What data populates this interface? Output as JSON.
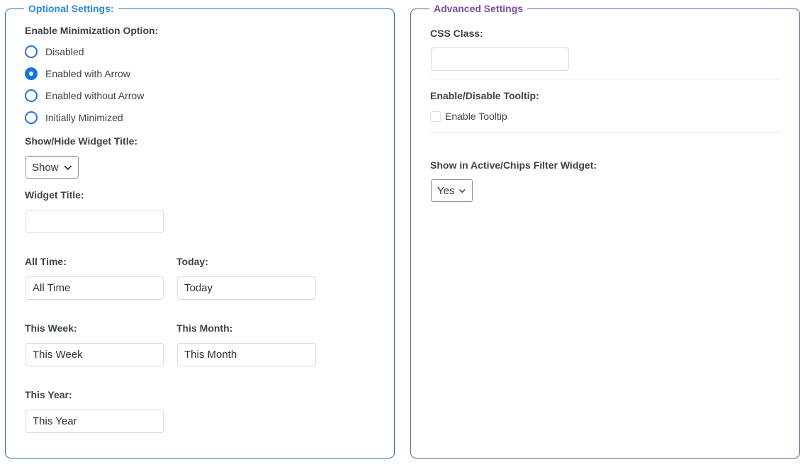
{
  "optional": {
    "legend": "Optional Settings:",
    "minimization": {
      "label": "Enable Minimization Option:",
      "options": [
        {
          "label": "Disabled",
          "checked": false
        },
        {
          "label": "Enabled with Arrow",
          "checked": true
        },
        {
          "label": "Enabled without Arrow",
          "checked": false
        },
        {
          "label": "Initially Minimized",
          "checked": false
        }
      ]
    },
    "show_hide_title": {
      "label": "Show/Hide Widget Title:",
      "selected": "Show"
    },
    "widget_title": {
      "label": "Widget Title:",
      "value": ""
    },
    "all_time": {
      "label": "All Time:",
      "value": "All Time"
    },
    "today": {
      "label": "Today:",
      "value": "Today"
    },
    "this_week": {
      "label": "This Week:",
      "value": "This Week"
    },
    "this_month": {
      "label": "This Month:",
      "value": "This Month"
    },
    "this_year": {
      "label": "This Year:",
      "value": "This Year"
    }
  },
  "advanced": {
    "legend": "Advanced Settings",
    "css_class": {
      "label": "CSS Class:",
      "value": ""
    },
    "tooltip": {
      "label": "Enable/Disable Tooltip:",
      "checkbox_label": "Enable Tooltip",
      "checked": false
    },
    "chips": {
      "label": "Show in Active/Chips Filter Widget:",
      "selected": "Yes"
    }
  },
  "colors": {
    "optional_border": "#2271b1",
    "optional_legend": "#2b88d8",
    "advanced_border": "#7e4c9e",
    "radio_accent": "#1473e6"
  },
  "icons": {
    "select_arrow": "chevron-down-icon"
  }
}
